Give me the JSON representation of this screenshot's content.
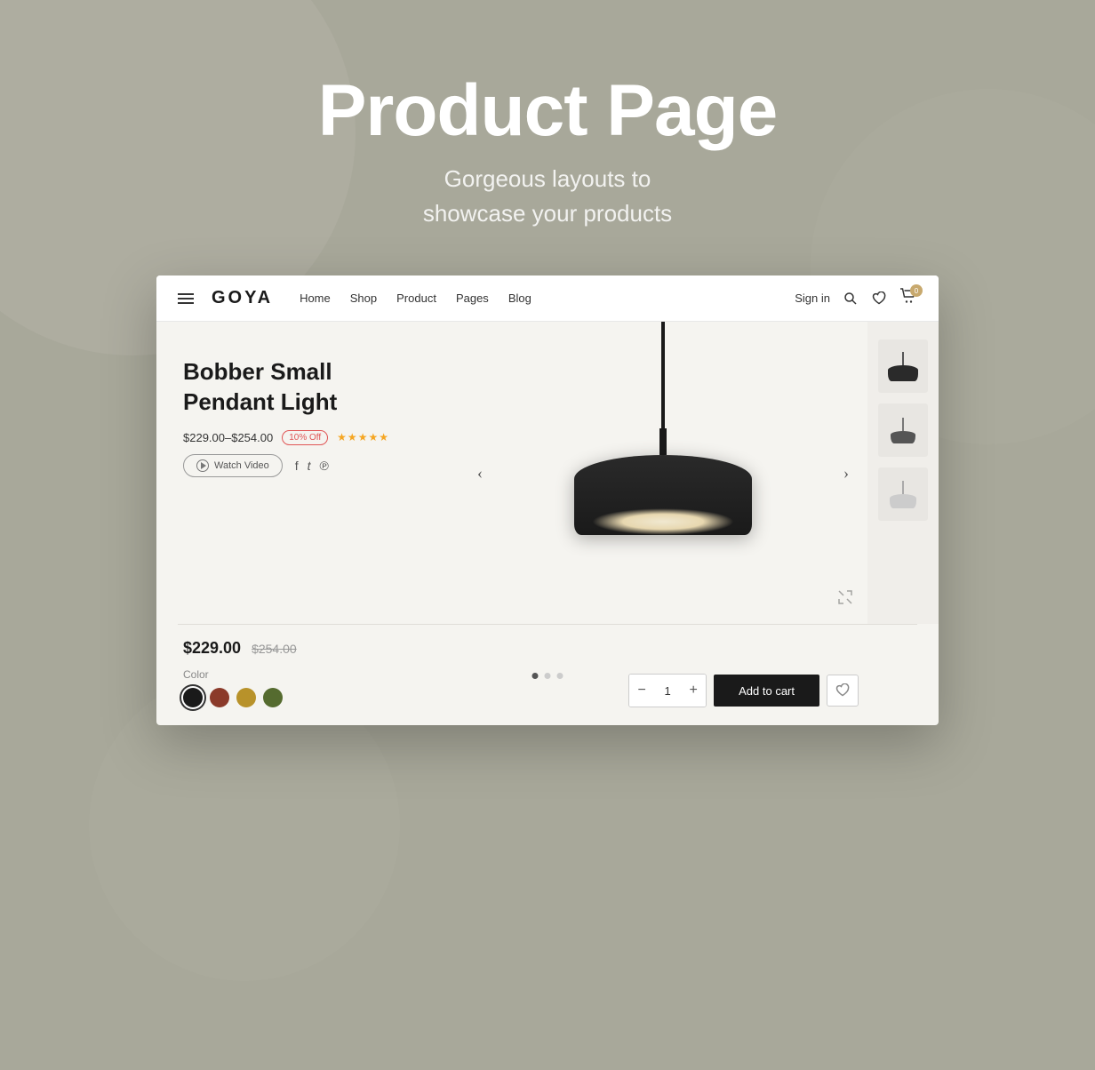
{
  "page": {
    "bg_color": "#a8a89a"
  },
  "hero": {
    "title": "Product Page",
    "subtitle_line1": "Gorgeous layouts to",
    "subtitle_line2": "showcase your products"
  },
  "navbar": {
    "logo": "GOYA",
    "links": [
      "Home",
      "Shop",
      "Product",
      "Pages",
      "Blog"
    ],
    "signin": "Sign in",
    "cart_count": "0"
  },
  "product": {
    "title_line1": "Bobber Small",
    "title_line2": "Pendant Light",
    "price_range": "$229.00–$254.00",
    "discount": "10% Off",
    "stars": "★★★★★",
    "watch_video": "Watch Video",
    "price_current": "$229.00",
    "price_original": "$254.00",
    "color_label": "Color",
    "colors": [
      {
        "name": "black",
        "hex": "#1a1a1a"
      },
      {
        "name": "red-brown",
        "hex": "#8b3a2a"
      },
      {
        "name": "gold",
        "hex": "#b8922a"
      },
      {
        "name": "olive",
        "hex": "#556b2f"
      }
    ],
    "quantity": "1",
    "add_to_cart": "Add to cart",
    "qty_minus": "−",
    "qty_plus": "+"
  },
  "carousel": {
    "dots": [
      true,
      false,
      false
    ],
    "left_arrow": "‹",
    "right_arrow": "›"
  }
}
